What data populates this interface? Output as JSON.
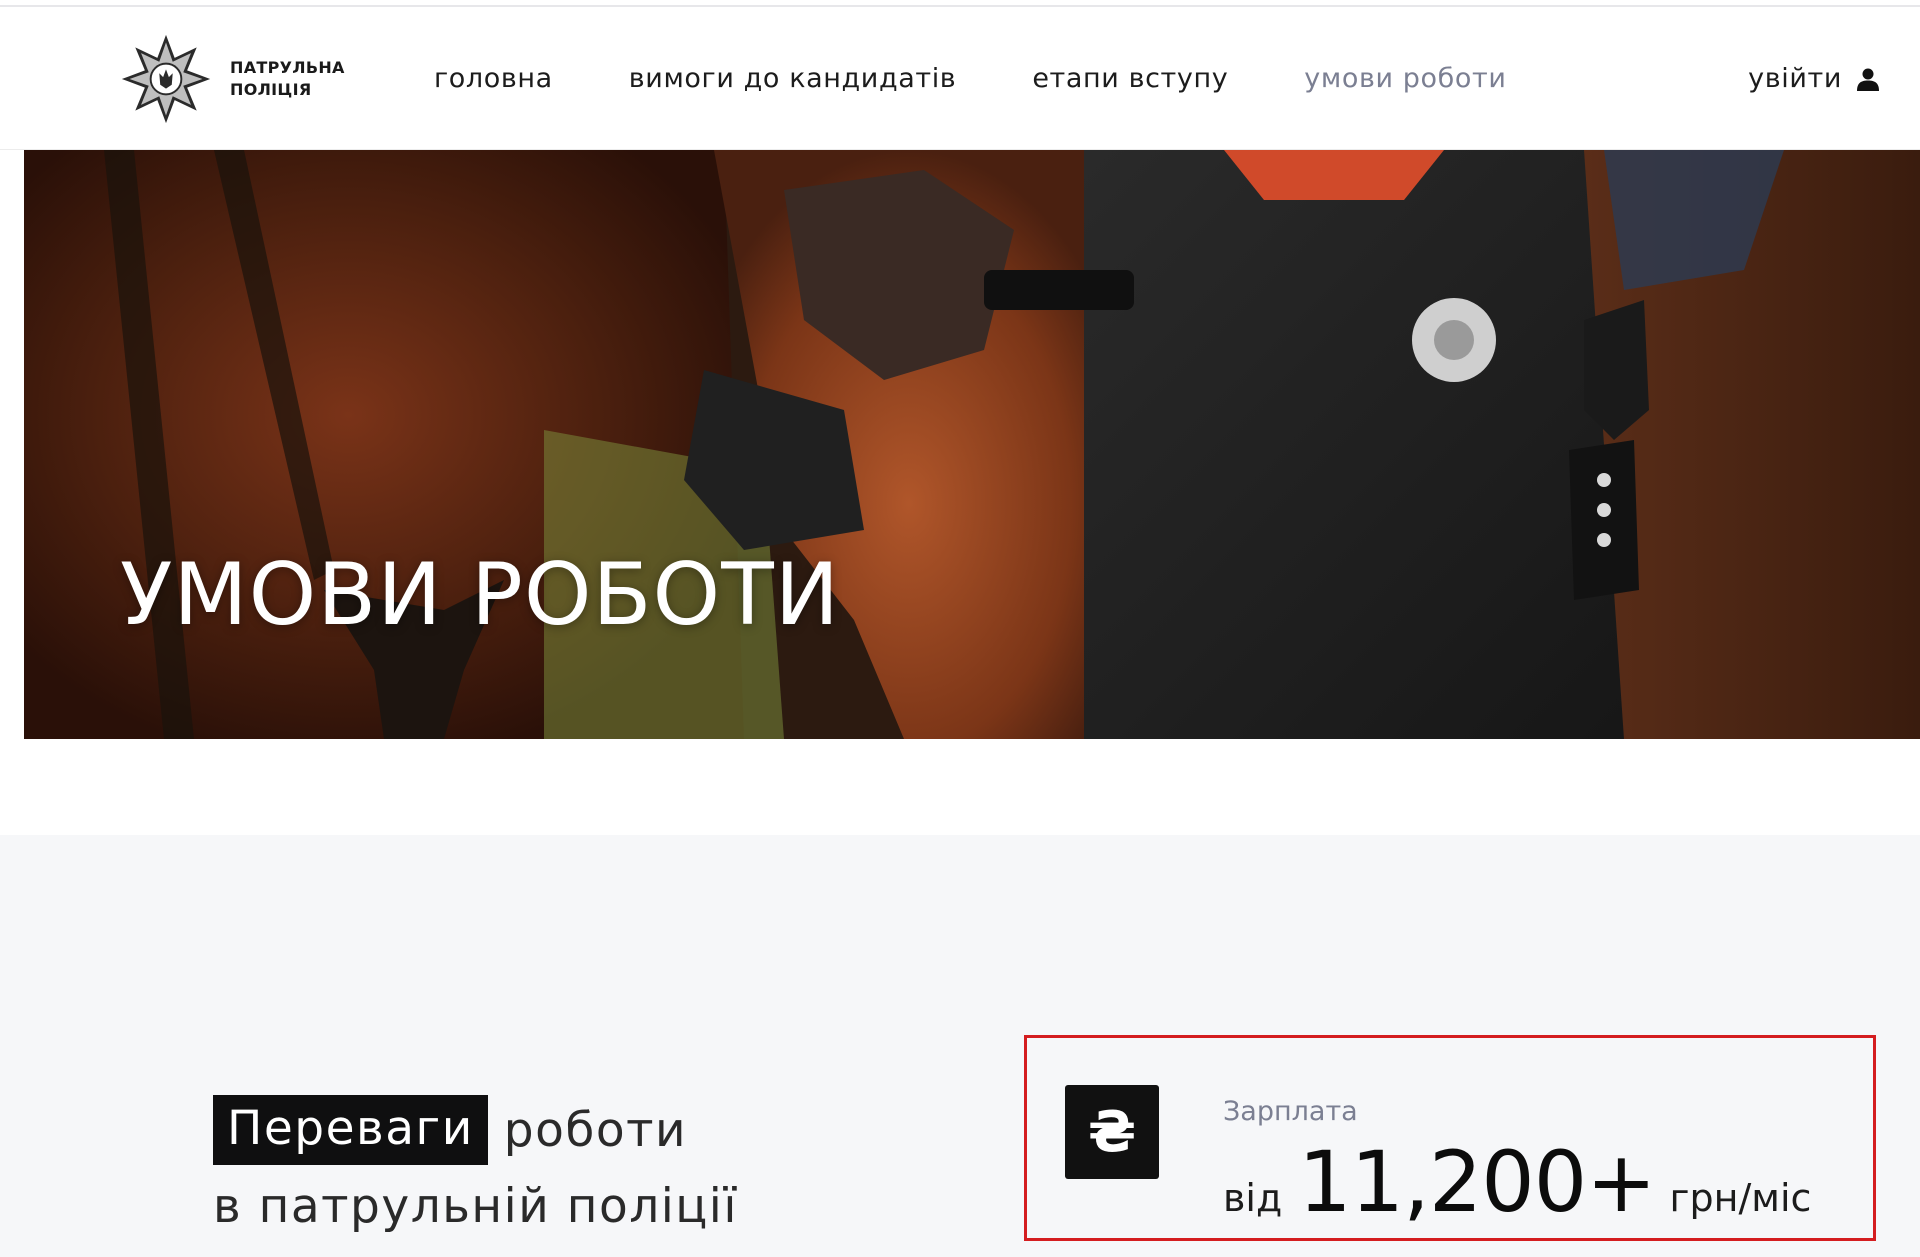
{
  "header": {
    "logo": {
      "line1": "ПАТРУЛЬНА",
      "line2": "ПОЛІЦІЯ"
    },
    "nav": [
      {
        "label": "головна",
        "active": false
      },
      {
        "label": "вимоги до кандидатів",
        "active": false
      },
      {
        "label": "етапи вступу",
        "active": false
      },
      {
        "label": "умови роботи",
        "active": true
      }
    ],
    "login_label": "увійти"
  },
  "hero": {
    "title": "УМОВИ РОБОТИ"
  },
  "benefits": {
    "heading_highlight": "Переваги",
    "heading_rest": "роботи",
    "heading_line2": "в патрульній поліції",
    "salary": {
      "icon": "hryvnia-icon",
      "icon_glyph": "₴",
      "label": "Зарплата",
      "prefix": "від",
      "amount": "11,200+",
      "unit": "грн/міс"
    }
  },
  "colors": {
    "accent_gray": "#7b7f92",
    "highlight_red": "#d41d20",
    "dark": "#0f0f10",
    "section_bg": "#f6f7f9"
  }
}
